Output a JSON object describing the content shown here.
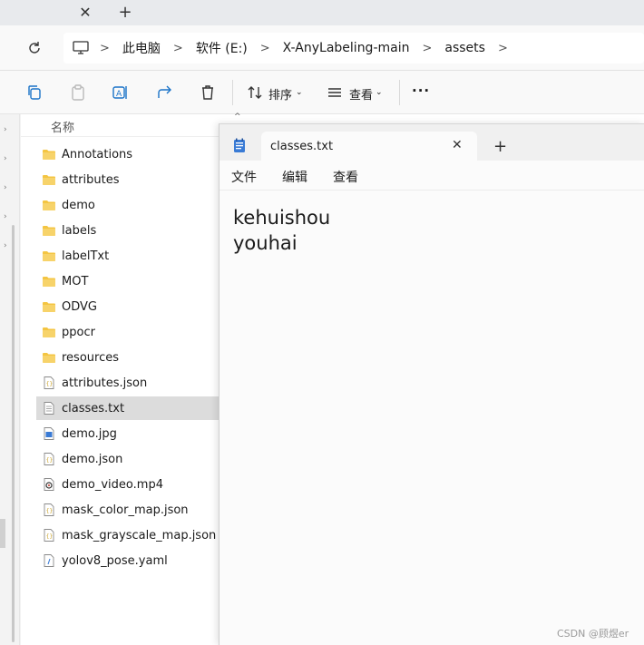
{
  "tabstrip": {
    "close_glyph": "✕",
    "new_glyph": "+"
  },
  "breadcrumb": [
    "此电脑",
    "软件 (E:)",
    "X-AnyLabeling-main",
    "assets"
  ],
  "toolbar": {
    "sort_label": "排序",
    "view_label": "查看",
    "more_label": "···"
  },
  "file_list": {
    "column_name": "名称",
    "items": [
      {
        "name": "Annotations",
        "type": "folder"
      },
      {
        "name": "attributes",
        "type": "folder"
      },
      {
        "name": "demo",
        "type": "folder"
      },
      {
        "name": "labels",
        "type": "folder"
      },
      {
        "name": "labelTxt",
        "type": "folder"
      },
      {
        "name": "MOT",
        "type": "folder"
      },
      {
        "name": "ODVG",
        "type": "folder"
      },
      {
        "name": "ppocr",
        "type": "folder"
      },
      {
        "name": "resources",
        "type": "folder"
      },
      {
        "name": "attributes.json",
        "type": "json"
      },
      {
        "name": "classes.txt",
        "type": "txt",
        "selected": true
      },
      {
        "name": "demo.jpg",
        "type": "image"
      },
      {
        "name": "demo.json",
        "type": "json"
      },
      {
        "name": "demo_video.mp4",
        "type": "video"
      },
      {
        "name": "mask_color_map.json",
        "type": "json"
      },
      {
        "name": "mask_grayscale_map.json",
        "type": "json"
      },
      {
        "name": "yolov8_pose.yaml",
        "type": "yaml"
      }
    ]
  },
  "notepad": {
    "tab_title": "classes.txt",
    "close_glyph": "✕",
    "new_tab_glyph": "+",
    "menu": [
      "文件",
      "编辑",
      "查看"
    ],
    "content": "kehuishou\nyouhai"
  },
  "watermark": "CSDN @顾煜er",
  "colors": {
    "folder": "#f4c542",
    "selected_row": "#dcdcdc",
    "accent": "#1a73c8"
  }
}
